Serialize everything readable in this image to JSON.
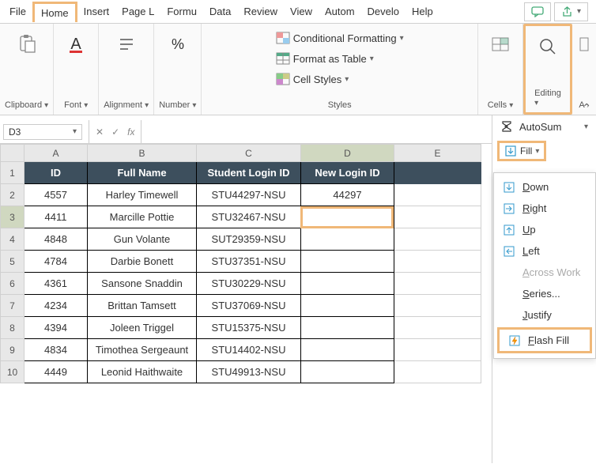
{
  "tabs": [
    "File",
    "Home",
    "Insert",
    "Page L",
    "Formu",
    "Data",
    "Review",
    "View",
    "Autom",
    "Develo",
    "Help"
  ],
  "activeTab": "Home",
  "ribbon": {
    "clipboard": "Clipboard",
    "font": "Font",
    "alignment": "Alignment",
    "number": "Number",
    "styles": "Styles",
    "cells": "Cells",
    "editing": "Editing",
    "condFormat": "Conditional Formatting",
    "formatTable": "Format as Table",
    "cellStyles": "Cell Styles"
  },
  "nameBox": "D3",
  "fx": "fx",
  "columns": [
    "A",
    "B",
    "C",
    "D",
    "E"
  ],
  "headerRow": [
    "ID",
    "Full Name",
    "Student Login ID",
    "New Login ID"
  ],
  "rows": [
    {
      "n": 2,
      "id": "4557",
      "name": "Harley Timewell",
      "login": "STU44297-NSU",
      "new": "44297"
    },
    {
      "n": 3,
      "id": "4411",
      "name": "Marcille Pottie",
      "login": "STU32467-NSU",
      "new": ""
    },
    {
      "n": 4,
      "id": "4848",
      "name": "Gun Volante",
      "login": "SUT29359-NSU",
      "new": ""
    },
    {
      "n": 5,
      "id": "4784",
      "name": "Darbie Bonett",
      "login": "STU37351-NSU",
      "new": ""
    },
    {
      "n": 6,
      "id": "4361",
      "name": "Sansone Snaddin",
      "login": "STU30229-NSU",
      "new": ""
    },
    {
      "n": 7,
      "id": "4234",
      "name": "Brittan Tamsett",
      "login": "STU37069-NSU",
      "new": ""
    },
    {
      "n": 8,
      "id": "4394",
      "name": "Joleen Triggel",
      "login": "STU15375-NSU",
      "new": ""
    },
    {
      "n": 9,
      "id": "4834",
      "name": "Timothea Sergeaunt",
      "login": "STU14402-NSU",
      "new": ""
    },
    {
      "n": 10,
      "id": "4449",
      "name": "Leonid Haithwaite",
      "login": "STU49913-NSU",
      "new": ""
    }
  ],
  "sidePanel": {
    "autoSum": "AutoSum",
    "fill": "Fill"
  },
  "fillMenu": {
    "down": "Down",
    "right": "Right",
    "up": "Up",
    "left": "Left",
    "across": "Across Work",
    "series": "Series...",
    "justify": "Justify",
    "flash": "Flash Fill"
  }
}
